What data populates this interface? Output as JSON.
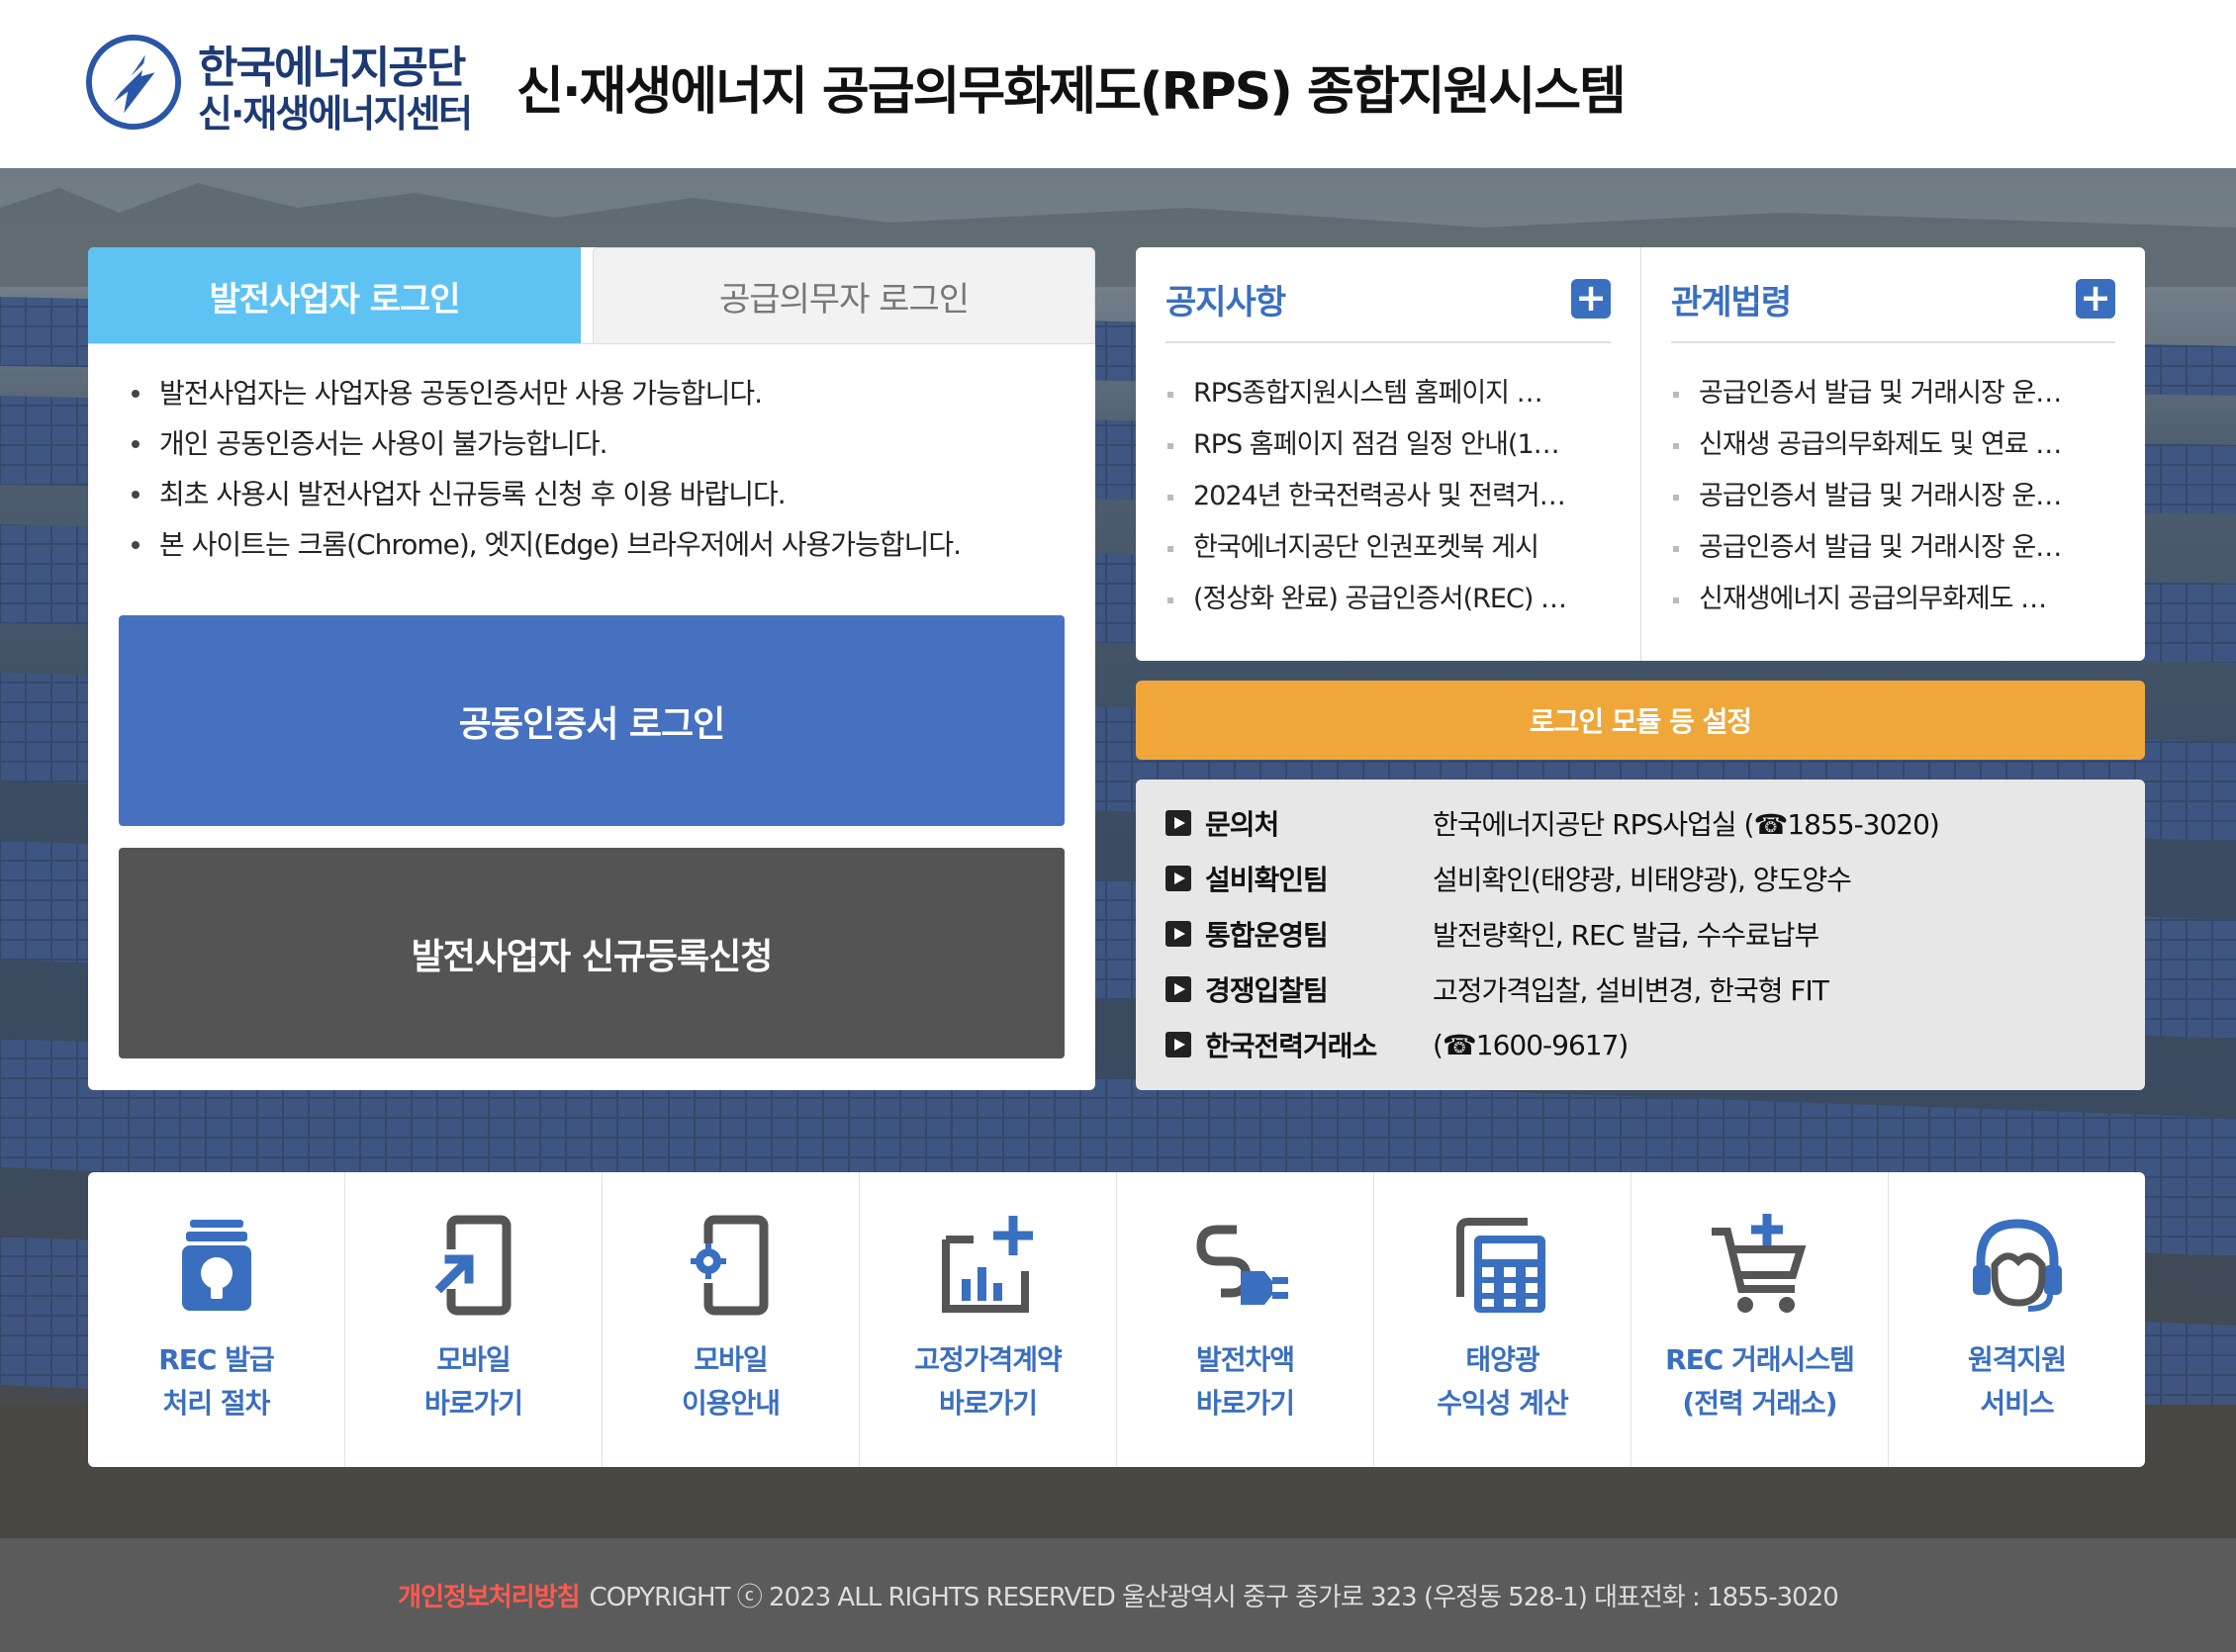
{
  "header": {
    "logo_line1": "한국에너지공단",
    "logo_line2": "신·재생에너지센터",
    "site_title": "신·재생에너지 공급의무화제도(RPS) 종합지원시스템"
  },
  "login": {
    "tab_active": "발전사업자 로그인",
    "tab_inactive": "공급의무자 로그인",
    "notices": [
      "발전사업자는 사업자용 공동인증서만 사용 가능합니다.",
      "개인 공동인증서는 사용이 불가능합니다.",
      "최초 사용시 발전사업자 신규등록 신청 후 이용 바랍니다.",
      "본 사이트는 크롬(Chrome), 엣지(Edge) 브라우저에서 사용가능합니다."
    ],
    "cert_button": "공동인증서 로그인",
    "register_button": "발전사업자 신규등록신청"
  },
  "notice_board": {
    "title": "공지사항",
    "plus": "+",
    "items": [
      "RPS종합지원시스템 홈페이지 …",
      "RPS 홈페이지 점검 일정 안내(1…",
      "2024년 한국전력공사 및 전력거…",
      "한국에너지공단 인권포켓북 게시",
      "(정상화 완료) 공급인증서(REC) …"
    ]
  },
  "law_board": {
    "title": "관계법령",
    "plus": "+",
    "items": [
      "공급인증서 발급 및 거래시장 운…",
      "신재생 공급의무화제도 및 연료 …",
      "공급인증서 발급 및 거래시장 운…",
      "공급인증서 발급 및 거래시장 운…",
      "신재생에너지 공급의무화제도 …"
    ]
  },
  "module_button": "로그인 모듈 등 설정",
  "contacts": [
    {
      "label": "문의처",
      "value": "한국에너지공단 RPS사업실 (☎1855-3020)"
    },
    {
      "label": "설비확인팀",
      "value": "설비확인(태양광, 비태양광), 양도양수"
    },
    {
      "label": "통합운영팀",
      "value": "발전량확인, REC 발급, 수수료납부"
    },
    {
      "label": "경쟁입찰팀",
      "value": "고정가격입찰, 설비변경, 한국형 FIT"
    },
    {
      "label": "한국전력거래소",
      "value": "(☎1600-9617)"
    }
  ],
  "quick_menu": [
    {
      "label": "REC 발급\n처리 절차",
      "icon": "bulb-doc-icon"
    },
    {
      "label": "모바일\n바로가기",
      "icon": "mobile-link-icon"
    },
    {
      "label": "모바일\n이용안내",
      "icon": "mobile-gear-icon"
    },
    {
      "label": "고정가격계약\n바로가기",
      "icon": "chart-plus-icon"
    },
    {
      "label": "발전차액\n바로가기",
      "icon": "plug-icon"
    },
    {
      "label": "태양광\n수익성 계산",
      "icon": "calculator-icon"
    },
    {
      "label": "REC 거래시스템\n(전력 거래소)",
      "icon": "cart-plus-icon"
    },
    {
      "label": "원격지원\n서비스",
      "icon": "headset-icon"
    }
  ],
  "footer": {
    "privacy": "개인정보처리방침",
    "copyright": "COPYRIGHT ⓒ 2023 ALL RIGHTS RESERVED 울산광역시 중구 종가로 323 (우정동 528-1) 대표전화 : 1855-3020"
  },
  "colors": {
    "primary_blue": "#3a6fc0",
    "tab_active": "#5ec3f3",
    "cert_button": "#4671c0",
    "module_button": "#f0a73a",
    "privacy_link": "#ff5a4e"
  }
}
